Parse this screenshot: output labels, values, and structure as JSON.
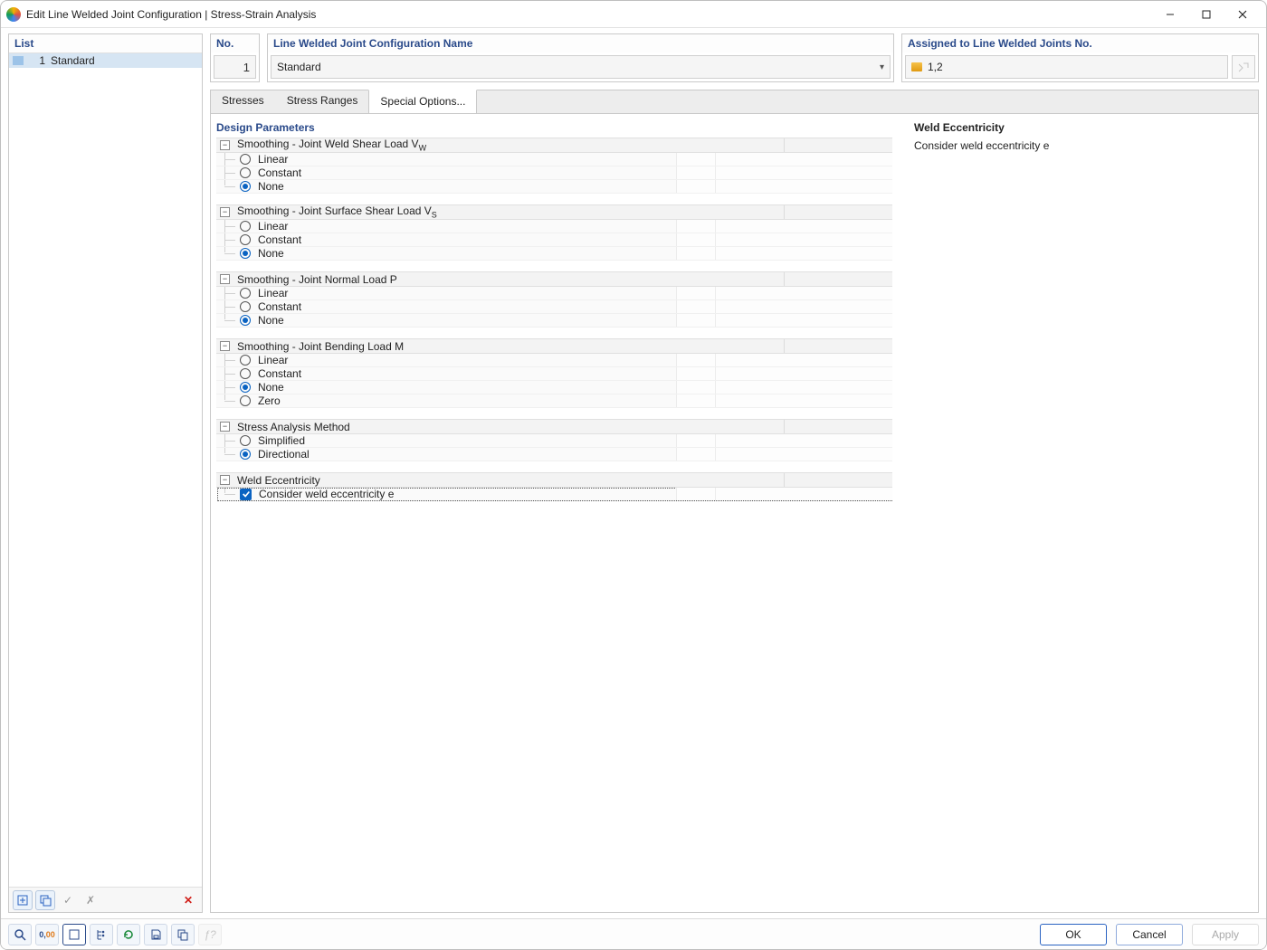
{
  "window": {
    "title": "Edit Line Welded Joint Configuration | Stress-Strain Analysis"
  },
  "leftPane": {
    "header": "List",
    "items": [
      {
        "num": "1",
        "name": "Standard"
      }
    ]
  },
  "header": {
    "noLabel": "No.",
    "noValue": "1",
    "nameLabel": "Line Welded Joint Configuration Name",
    "nameValue": "Standard",
    "assignedLabel": "Assigned to Line Welded Joints No.",
    "assignedValue": "1,2"
  },
  "tabs": {
    "t1": "Stresses",
    "t2": "Stress Ranges",
    "t3": "Special Options..."
  },
  "params": {
    "title": "Design Parameters",
    "groups": {
      "g1": {
        "label": "Smoothing - Joint Weld Shear Load V",
        "sub": "W",
        "opts": {
          "o1": "Linear",
          "o2": "Constant",
          "o3": "None"
        },
        "sel": "o3"
      },
      "g2": {
        "label": "Smoothing - Joint Surface Shear Load V",
        "sub": "S",
        "opts": {
          "o1": "Linear",
          "o2": "Constant",
          "o3": "None"
        },
        "sel": "o3"
      },
      "g3": {
        "label": "Smoothing - Joint Normal Load P",
        "opts": {
          "o1": "Linear",
          "o2": "Constant",
          "o3": "None"
        },
        "sel": "o3"
      },
      "g4": {
        "label": "Smoothing - Joint Bending Load M",
        "opts": {
          "o1": "Linear",
          "o2": "Constant",
          "o3": "None",
          "o4": "Zero"
        },
        "sel": "o3"
      },
      "g5": {
        "label": "Stress Analysis Method",
        "opts": {
          "o1": "Simplified",
          "o2": "Directional"
        },
        "sel": "o2"
      },
      "g6": {
        "label": "Weld Eccentricity",
        "check": {
          "label": "Consider weld eccentricity e",
          "sel": true
        }
      }
    }
  },
  "info": {
    "title": "Weld Eccentricity",
    "text": "Consider weld eccentricity e"
  },
  "footer": {
    "ok": "OK",
    "cancel": "Cancel",
    "apply": "Apply"
  }
}
